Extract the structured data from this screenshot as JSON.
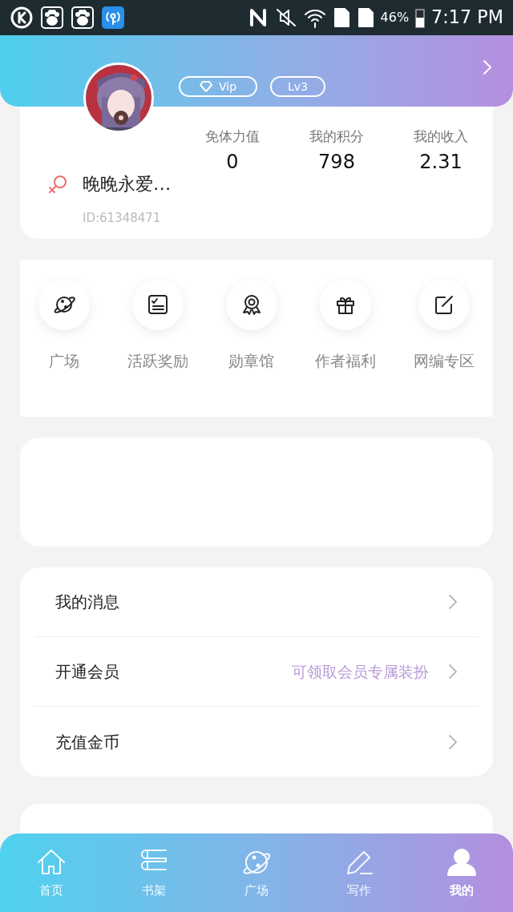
{
  "status_bar": {
    "battery": "46%",
    "time": "7:17 PM"
  },
  "profile": {
    "badges": [
      "Vip",
      "Lv3"
    ],
    "name": "晚晚永爱…",
    "id": "ID:61348471",
    "stats": [
      {
        "label": "免体力值",
        "value": "0"
      },
      {
        "label": "我的积分",
        "value": "798"
      },
      {
        "label": "我的收入",
        "value": "2.31"
      }
    ]
  },
  "shortcuts": [
    {
      "kind": "planet",
      "label": "广场"
    },
    {
      "kind": "checklist",
      "label": "活跃奖励"
    },
    {
      "kind": "medal",
      "label": "勋章馆"
    },
    {
      "kind": "gift",
      "label": "作者福利"
    },
    {
      "kind": "edit",
      "label": "网编专区"
    }
  ],
  "menu": [
    {
      "label": "我的消息"
    },
    {
      "label": "开通会员",
      "note": "可领取会员专属装扮"
    },
    {
      "label": "充值金币"
    }
  ],
  "bottom_nav": [
    {
      "kind": "home",
      "label": "首页",
      "selected": false
    },
    {
      "kind": "shelf",
      "label": "书架",
      "selected": false
    },
    {
      "kind": "planet",
      "label": "广场",
      "selected": false
    },
    {
      "kind": "pen",
      "label": "写作",
      "selected": false
    },
    {
      "kind": "user",
      "label": "我的",
      "selected": true
    }
  ]
}
